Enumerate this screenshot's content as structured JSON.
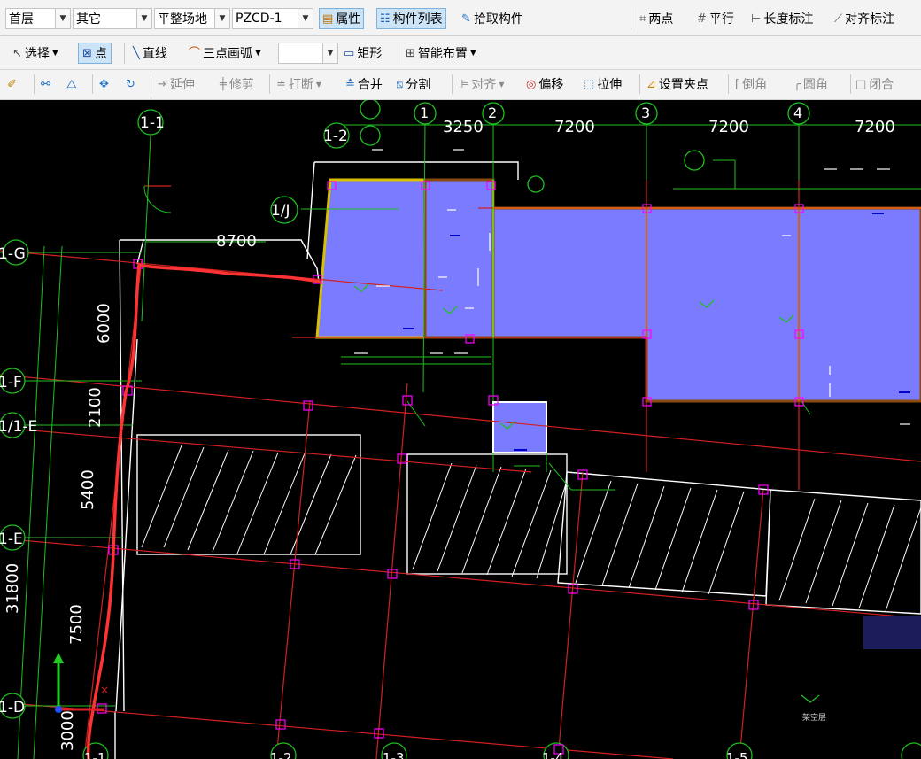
{
  "toolbar1": {
    "floor": "首层",
    "category": "其它",
    "component_type": "平整场地",
    "component_name": "PZCD-1",
    "properties_label": "属性",
    "component_list_label": "构件列表",
    "pick_component_label": "拾取构件",
    "two_point_label": "两点",
    "parallel_label": "平行",
    "length_dim_label": "长度标注",
    "aligned_dim_label": "对齐标注"
  },
  "toolbar2": {
    "select_label": "选择",
    "point_label": "点",
    "line_label": "直线",
    "arc_label": "三点画弧",
    "blank_combo": "",
    "rect_label": "矩形",
    "smart_layout_label": "智能布置"
  },
  "toolbar3": {
    "extend_label": "延伸",
    "trim_label": "修剪",
    "break_label": "打断",
    "merge_label": "合并",
    "split_label": "分割",
    "align_label": "对齐",
    "offset_label": "偏移",
    "stretch_label": "拉伸",
    "set_grip_label": "设置夹点",
    "chamfer_label": "倒角",
    "fillet_label": "圆角",
    "close_label": "闭合"
  },
  "canvas": {
    "grid_labels_top": [
      "1-1",
      "1",
      "2",
      "3",
      "4"
    ],
    "grid_label_1_2": "1-2",
    "grid_label_1_j": "1/J",
    "grid_labels_left": [
      "1-G",
      "1-F",
      "1/1-E",
      "1-E",
      "1-D"
    ],
    "grid_labels_bottom": [
      "1-1",
      "1-2",
      "1-3",
      "1-4",
      "1-5"
    ],
    "dims_top": [
      "3250",
      "7200",
      "7200",
      "7200"
    ],
    "dim_8700": "8700",
    "dims_left": [
      "6000",
      "2100",
      "5400",
      "7500",
      "3000"
    ],
    "dim_total_left": "31800",
    "note_label": "架空层",
    "colors": {
      "fill": "#7b7bff",
      "axis_red": "#d22020",
      "green": "#1fbf1f",
      "yellow_border": "#d8c000",
      "brown_border": "#8a4a10",
      "grip": "#ff00ff",
      "sketch": "#ff3333"
    }
  }
}
